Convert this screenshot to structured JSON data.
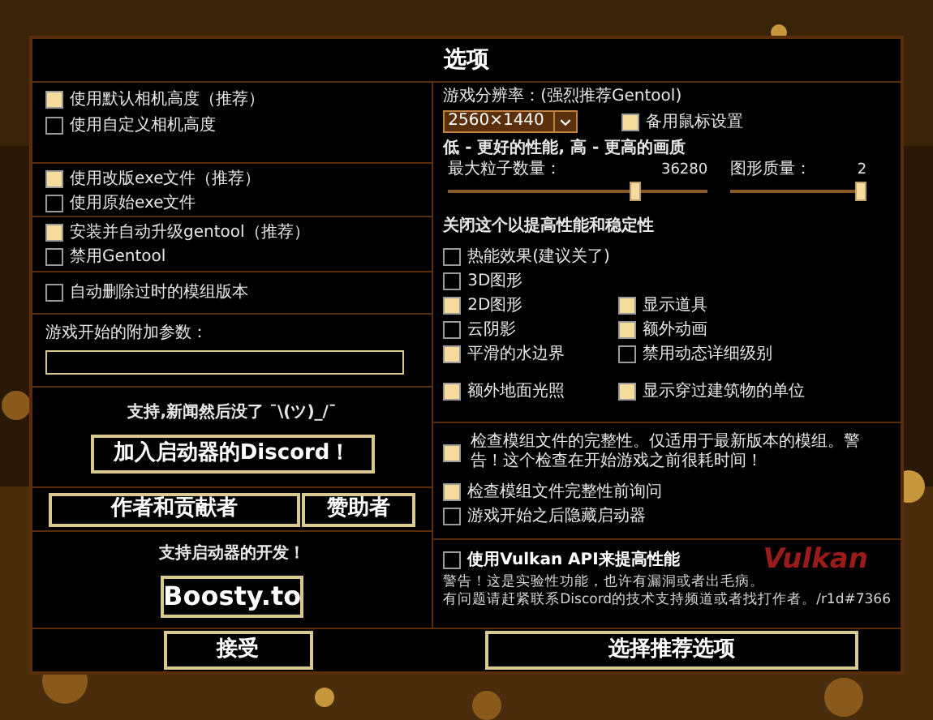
{
  "dialog": {
    "title": "选项"
  },
  "camera_options": [
    {
      "label": "使用默认相机高度（推荐）",
      "checked": true
    },
    {
      "label": "使用自定义相机高度",
      "checked": false
    }
  ],
  "exe_options": [
    {
      "label": "使用改版exe文件（推荐）",
      "checked": true
    },
    {
      "label": "使用原始exe文件",
      "checked": false
    }
  ],
  "gentool_options": [
    {
      "label": "安装并自动升级gentool（推荐）",
      "checked": true
    },
    {
      "label": "禁用Gentool",
      "checked": false
    }
  ],
  "cleanup_options": [
    {
      "label": "自动删除过时的模组版本",
      "checked": false
    }
  ],
  "launch_args": {
    "label": "游戏开始的附加参数："
  },
  "news": {
    "text": "支持,新闻然后没了 ¯\\(ツ)_/¯",
    "button": "加入启动器的Discord！"
  },
  "credits_buttons": [
    "作者和贡献者",
    "赞助者"
  ],
  "support": {
    "text": "支持启动器的开发！",
    "button": "Boosty.to"
  },
  "accept_button": "接受",
  "resolution": {
    "label": "游戏分辨率：(强烈推荐Gentool)",
    "value": "2560×1440",
    "alt_mouse": {
      "label": "备用鼠标设置",
      "checked": true
    }
  },
  "quality_hint": "低 - 更好的性能, 高 - 更高的画质",
  "sliders": [
    {
      "label": "最大粒子数量：",
      "reading": "36280",
      "level": 0.73
    },
    {
      "label": "图形质量：",
      "reading": "2",
      "level": 1
    }
  ],
  "performance": {
    "heading": "关闭这个以提高性能和稳定性",
    "rows": [
      [
        {
          "label": "热能效果(建议关了)",
          "checked": false
        }
      ],
      [
        {
          "label": "3D图形",
          "checked": false
        }
      ],
      [
        {
          "label": "2D图形",
          "checked": true
        },
        {
          "label": "显示道具",
          "checked": true
        }
      ],
      [
        {
          "label": "云阴影",
          "checked": false
        },
        {
          "label": "额外动画",
          "checked": true
        }
      ],
      [
        {
          "label": "平滑的水边界",
          "checked": true
        },
        {
          "label": "禁用动态详细级别",
          "checked": false
        }
      ],
      [
        {
          "label": "额外地面光照",
          "checked": true
        },
        {
          "label": "显示穿过建筑物的单位",
          "checked": true
        }
      ]
    ]
  },
  "integrity_options": [
    {
      "label": "检查模组文件的完整性。仅适用于最新版本的模组。警告！这个检查在开始游戏之前很耗时间！",
      "checked": true
    },
    {
      "label": "检查模组文件完整性前询问",
      "checked": true
    },
    {
      "label": "游戏开始之后隐藏启动器",
      "checked": false
    }
  ],
  "vulkan": {
    "label": "使用Vulkan API来提高性能",
    "checked": false,
    "logo": "Vulkan",
    "warnings": [
      "警告！这是实验性功能，也许有漏洞或者出毛病。",
      "有问题请赶紧联系Discord的技术支持频道或者找打作者。/r1d#7366"
    ]
  },
  "recommended_button": "选择推荐选项"
}
